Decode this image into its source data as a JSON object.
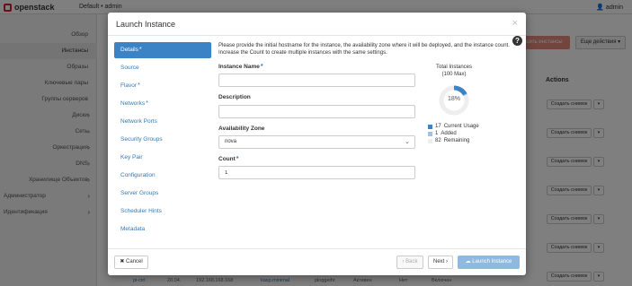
{
  "topbar": {
    "brand": "openstack",
    "project": "Default • admin",
    "user": "admin"
  },
  "sidebar": {
    "items": [
      {
        "label": "Обзор"
      },
      {
        "label": "Инстансы"
      },
      {
        "label": "Образы"
      },
      {
        "label": "Ключевые пары"
      },
      {
        "label": "Группы серверов"
      },
      {
        "label": "Диски"
      },
      {
        "label": "Сеть"
      },
      {
        "label": "Оркестрация"
      },
      {
        "label": "DNS"
      },
      {
        "label": "Хранилище Объектов"
      },
      {
        "label": "Администратор"
      },
      {
        "label": "Идентификация"
      }
    ]
  },
  "page": {
    "launch_button": "...сить инстансы",
    "more_actions": "Еще действия ▾",
    "actions_header": "Actions",
    "row_action": "Создать снимок",
    "bottom_row": {
      "name": "pi-ctrl",
      "date": "20.04.",
      "ip": "192.168.168.168",
      "flavor": "kasp.minimal",
      "image": "ploggeihr",
      "status": "Активен",
      "no": "Нет",
      "power": "Включен"
    }
  },
  "modal": {
    "title": "Launch Instance",
    "close": "×",
    "help": "?",
    "steps": [
      {
        "label": "Details",
        "required": true
      },
      {
        "label": "Source",
        "required": false
      },
      {
        "label": "Flavor",
        "required": true
      },
      {
        "label": "Networks",
        "required": true
      },
      {
        "label": "Network Ports",
        "required": false
      },
      {
        "label": "Security Groups",
        "required": false
      },
      {
        "label": "Key Pair",
        "required": false
      },
      {
        "label": "Configuration",
        "required": false
      },
      {
        "label": "Server Groups",
        "required": false
      },
      {
        "label": "Scheduler Hints",
        "required": false
      },
      {
        "label": "Metadata",
        "required": false
      }
    ],
    "intro": "Please provide the initial hostname for the instance, the availability zone where it will be deployed, and the instance count. Increase the Count to create multiple instances with the same settings.",
    "fields": {
      "instance_name_label": "Instance Name",
      "instance_name_value": "",
      "description_label": "Description",
      "description_value": "",
      "availability_zone_label": "Availability Zone",
      "availability_zone_value": "nova",
      "count_label": "Count",
      "count_value": "1"
    },
    "quota": {
      "title": "Total Instances",
      "subtitle": "(100 Max)",
      "percent_label": "18%",
      "used_fraction": 0.17,
      "added_fraction": 0.01,
      "legend": [
        {
          "value": "17",
          "label": "Current Usage",
          "color": "#3b83c4"
        },
        {
          "value": "1",
          "label": "Added",
          "color": "#9dc3e6"
        },
        {
          "value": "82",
          "label": "Remaining",
          "color": "#eeeeee"
        }
      ]
    },
    "footer": {
      "cancel": "✖ Cancel",
      "back": "‹ Back",
      "next": "Next ›",
      "launch": "☁ Launch Instance"
    }
  }
}
